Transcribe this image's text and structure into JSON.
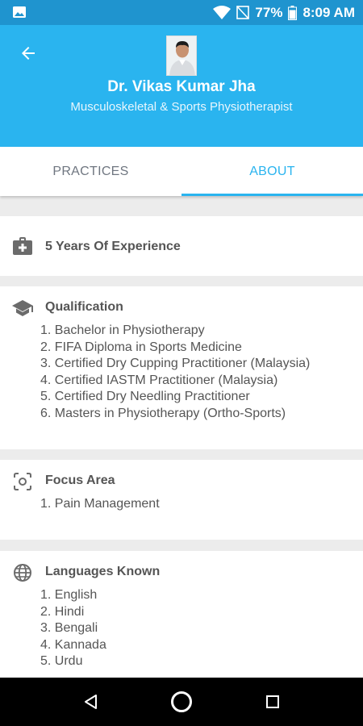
{
  "status_bar": {
    "battery_percent": "77%",
    "time": "8:09 AM"
  },
  "header": {
    "doctor_name": "Dr. Vikas Kumar Jha",
    "specialty": "Musculoskeletal & Sports Physiotherapist"
  },
  "tabs": [
    {
      "label": "PRACTICES",
      "active": false
    },
    {
      "label": "ABOUT",
      "active": true
    }
  ],
  "experience": {
    "text": "5 Years Of Experience",
    "icon": "medical-kit-icon"
  },
  "qualification": {
    "title": "Qualification",
    "icon": "graduation-cap-icon",
    "items": [
      "1. Bachelor in Physiotherapy",
      "2. FIFA Diploma in Sports Medicine",
      "3. Certified Dry Cupping Practitioner (Malaysia)",
      "4. Certified IASTM Practitioner (Malaysia)",
      "5. Certified Dry Needling Practitioner",
      "6. Masters in Physiotherapy (Ortho-Sports)"
    ]
  },
  "focus_area": {
    "title": "Focus Area",
    "icon": "focus-center-icon",
    "items": [
      "1. Pain Management"
    ]
  },
  "languages": {
    "title": "Languages Known",
    "icon": "globe-icon",
    "items": [
      "1. English",
      "2. Hindi",
      "3. Bengali",
      "4. Kannada",
      "5. Urdu"
    ]
  },
  "colors": {
    "header_bg": "#2ab4ef",
    "status_bg": "#1f94cf",
    "accent": "#2ab4ef"
  }
}
